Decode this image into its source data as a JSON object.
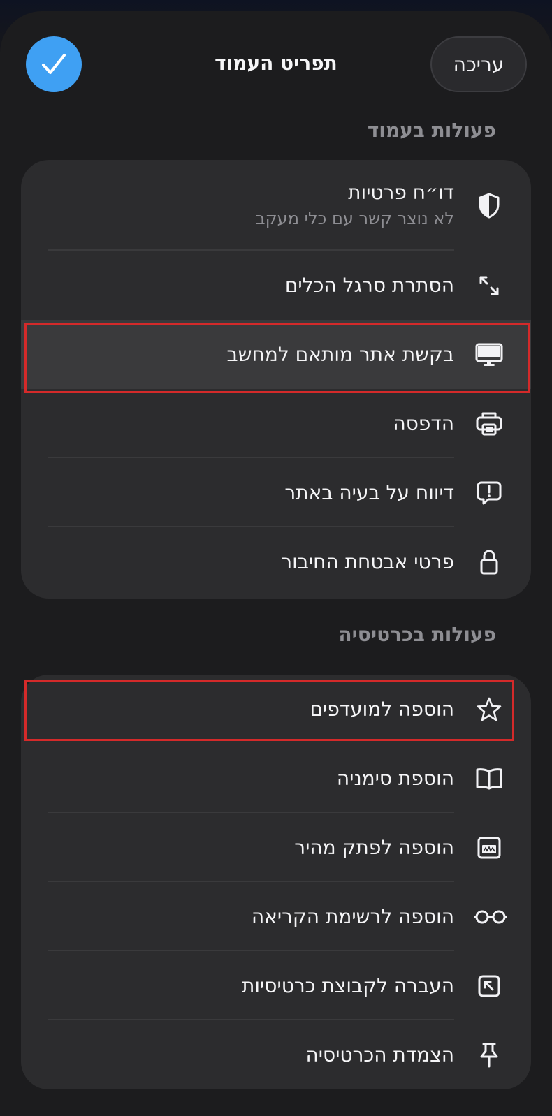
{
  "header": {
    "edit_label": "עריכה",
    "title": "תפריט העמוד",
    "done_icon": "checkmark-icon"
  },
  "page_actions": {
    "section_label": "פעולות בעמוד",
    "items": [
      {
        "label": "דו״ח פרטיות",
        "sublabel": "לא נוצר קשר עם כלי מעקב",
        "icon": "shield-icon"
      },
      {
        "label": "הסתרת סרגל הכלים",
        "icon": "expand-arrows-icon"
      },
      {
        "label": "בקשת אתר מותאם למחשב",
        "icon": "desktop-icon"
      },
      {
        "label": "הדפסה",
        "icon": "printer-icon"
      },
      {
        "label": "דיווח על בעיה באתר",
        "icon": "report-bubble-icon"
      },
      {
        "label": "פרטי אבטחת החיבור",
        "icon": "lock-icon"
      }
    ]
  },
  "tab_actions": {
    "section_label": "פעולות בכרטיסיה",
    "items": [
      {
        "label": "הוספה למועדפים",
        "icon": "star-icon"
      },
      {
        "label": "הוספת סימניה",
        "icon": "book-icon"
      },
      {
        "label": "הוספה לפתק מהיר",
        "icon": "quick-note-icon"
      },
      {
        "label": "הוספה לרשימת הקריאה",
        "icon": "glasses-icon"
      },
      {
        "label": "העברה לקבוצת כרטיסיות",
        "icon": "move-to-group-icon"
      },
      {
        "label": "הצמדת הכרטיסיה",
        "icon": "pin-icon"
      }
    ]
  },
  "colors": {
    "accent": "#3fa0f3",
    "background": "#1c1c1e",
    "group": "#2c2c2e",
    "highlight_mark": "#d42a2a"
  }
}
